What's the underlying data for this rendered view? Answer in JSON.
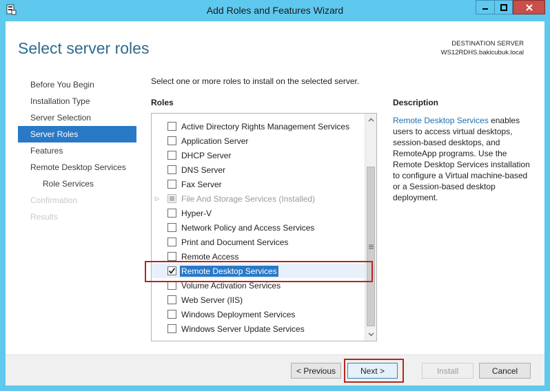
{
  "window": {
    "title": "Add Roles and Features Wizard"
  },
  "page": {
    "title": "Select server roles",
    "destination_label": "DESTINATION SERVER",
    "destination_server": "WS12RDHS.bakicubuk.local"
  },
  "nav": {
    "items": [
      {
        "label": "Before You Begin",
        "state": "normal"
      },
      {
        "label": "Installation Type",
        "state": "normal"
      },
      {
        "label": "Server Selection",
        "state": "normal"
      },
      {
        "label": "Server Roles",
        "state": "active"
      },
      {
        "label": "Features",
        "state": "normal"
      },
      {
        "label": "Remote Desktop Services",
        "state": "normal"
      },
      {
        "label": "Role Services",
        "state": "sub"
      },
      {
        "label": "Confirmation",
        "state": "disabled"
      },
      {
        "label": "Results",
        "state": "disabled"
      }
    ]
  },
  "main": {
    "instruction": "Select one or more roles to install on the selected server.",
    "roles_label": "Roles",
    "roles": [
      {
        "label": "Active Directory Rights Management Services",
        "checked": false
      },
      {
        "label": "Application Server",
        "checked": false
      },
      {
        "label": "DHCP Server",
        "checked": false
      },
      {
        "label": "DNS Server",
        "checked": false
      },
      {
        "label": "Fax Server",
        "checked": false
      },
      {
        "label": "File And Storage Services (Installed)",
        "checked": "indeterminate",
        "disabled": true,
        "expandable": true
      },
      {
        "label": "Hyper-V",
        "checked": false
      },
      {
        "label": "Network Policy and Access Services",
        "checked": false
      },
      {
        "label": "Print and Document Services",
        "checked": false
      },
      {
        "label": "Remote Access",
        "checked": false
      },
      {
        "label": "Remote Desktop Services",
        "checked": true,
        "selected": true
      },
      {
        "label": "Volume Activation Services",
        "checked": false
      },
      {
        "label": "Web Server (IIS)",
        "checked": false
      },
      {
        "label": "Windows Deployment Services",
        "checked": false
      },
      {
        "label": "Windows Server Update Services",
        "checked": false
      }
    ]
  },
  "description": {
    "title": "Description",
    "link_text": "Remote Desktop Services",
    "text": " enables users to access virtual desktops, session-based desktops, and RemoteApp programs. Use the Remote Desktop Services installation to configure a Virtual machine-based or a Session-based desktop deployment."
  },
  "footer": {
    "previous": "< Previous",
    "next": "Next >",
    "install": "Install",
    "cancel": "Cancel"
  },
  "colors": {
    "titlebar": "#5ec8ef",
    "accent": "#2a79c7",
    "page_title": "#2d6b8f",
    "highlight": "#b3261e"
  }
}
